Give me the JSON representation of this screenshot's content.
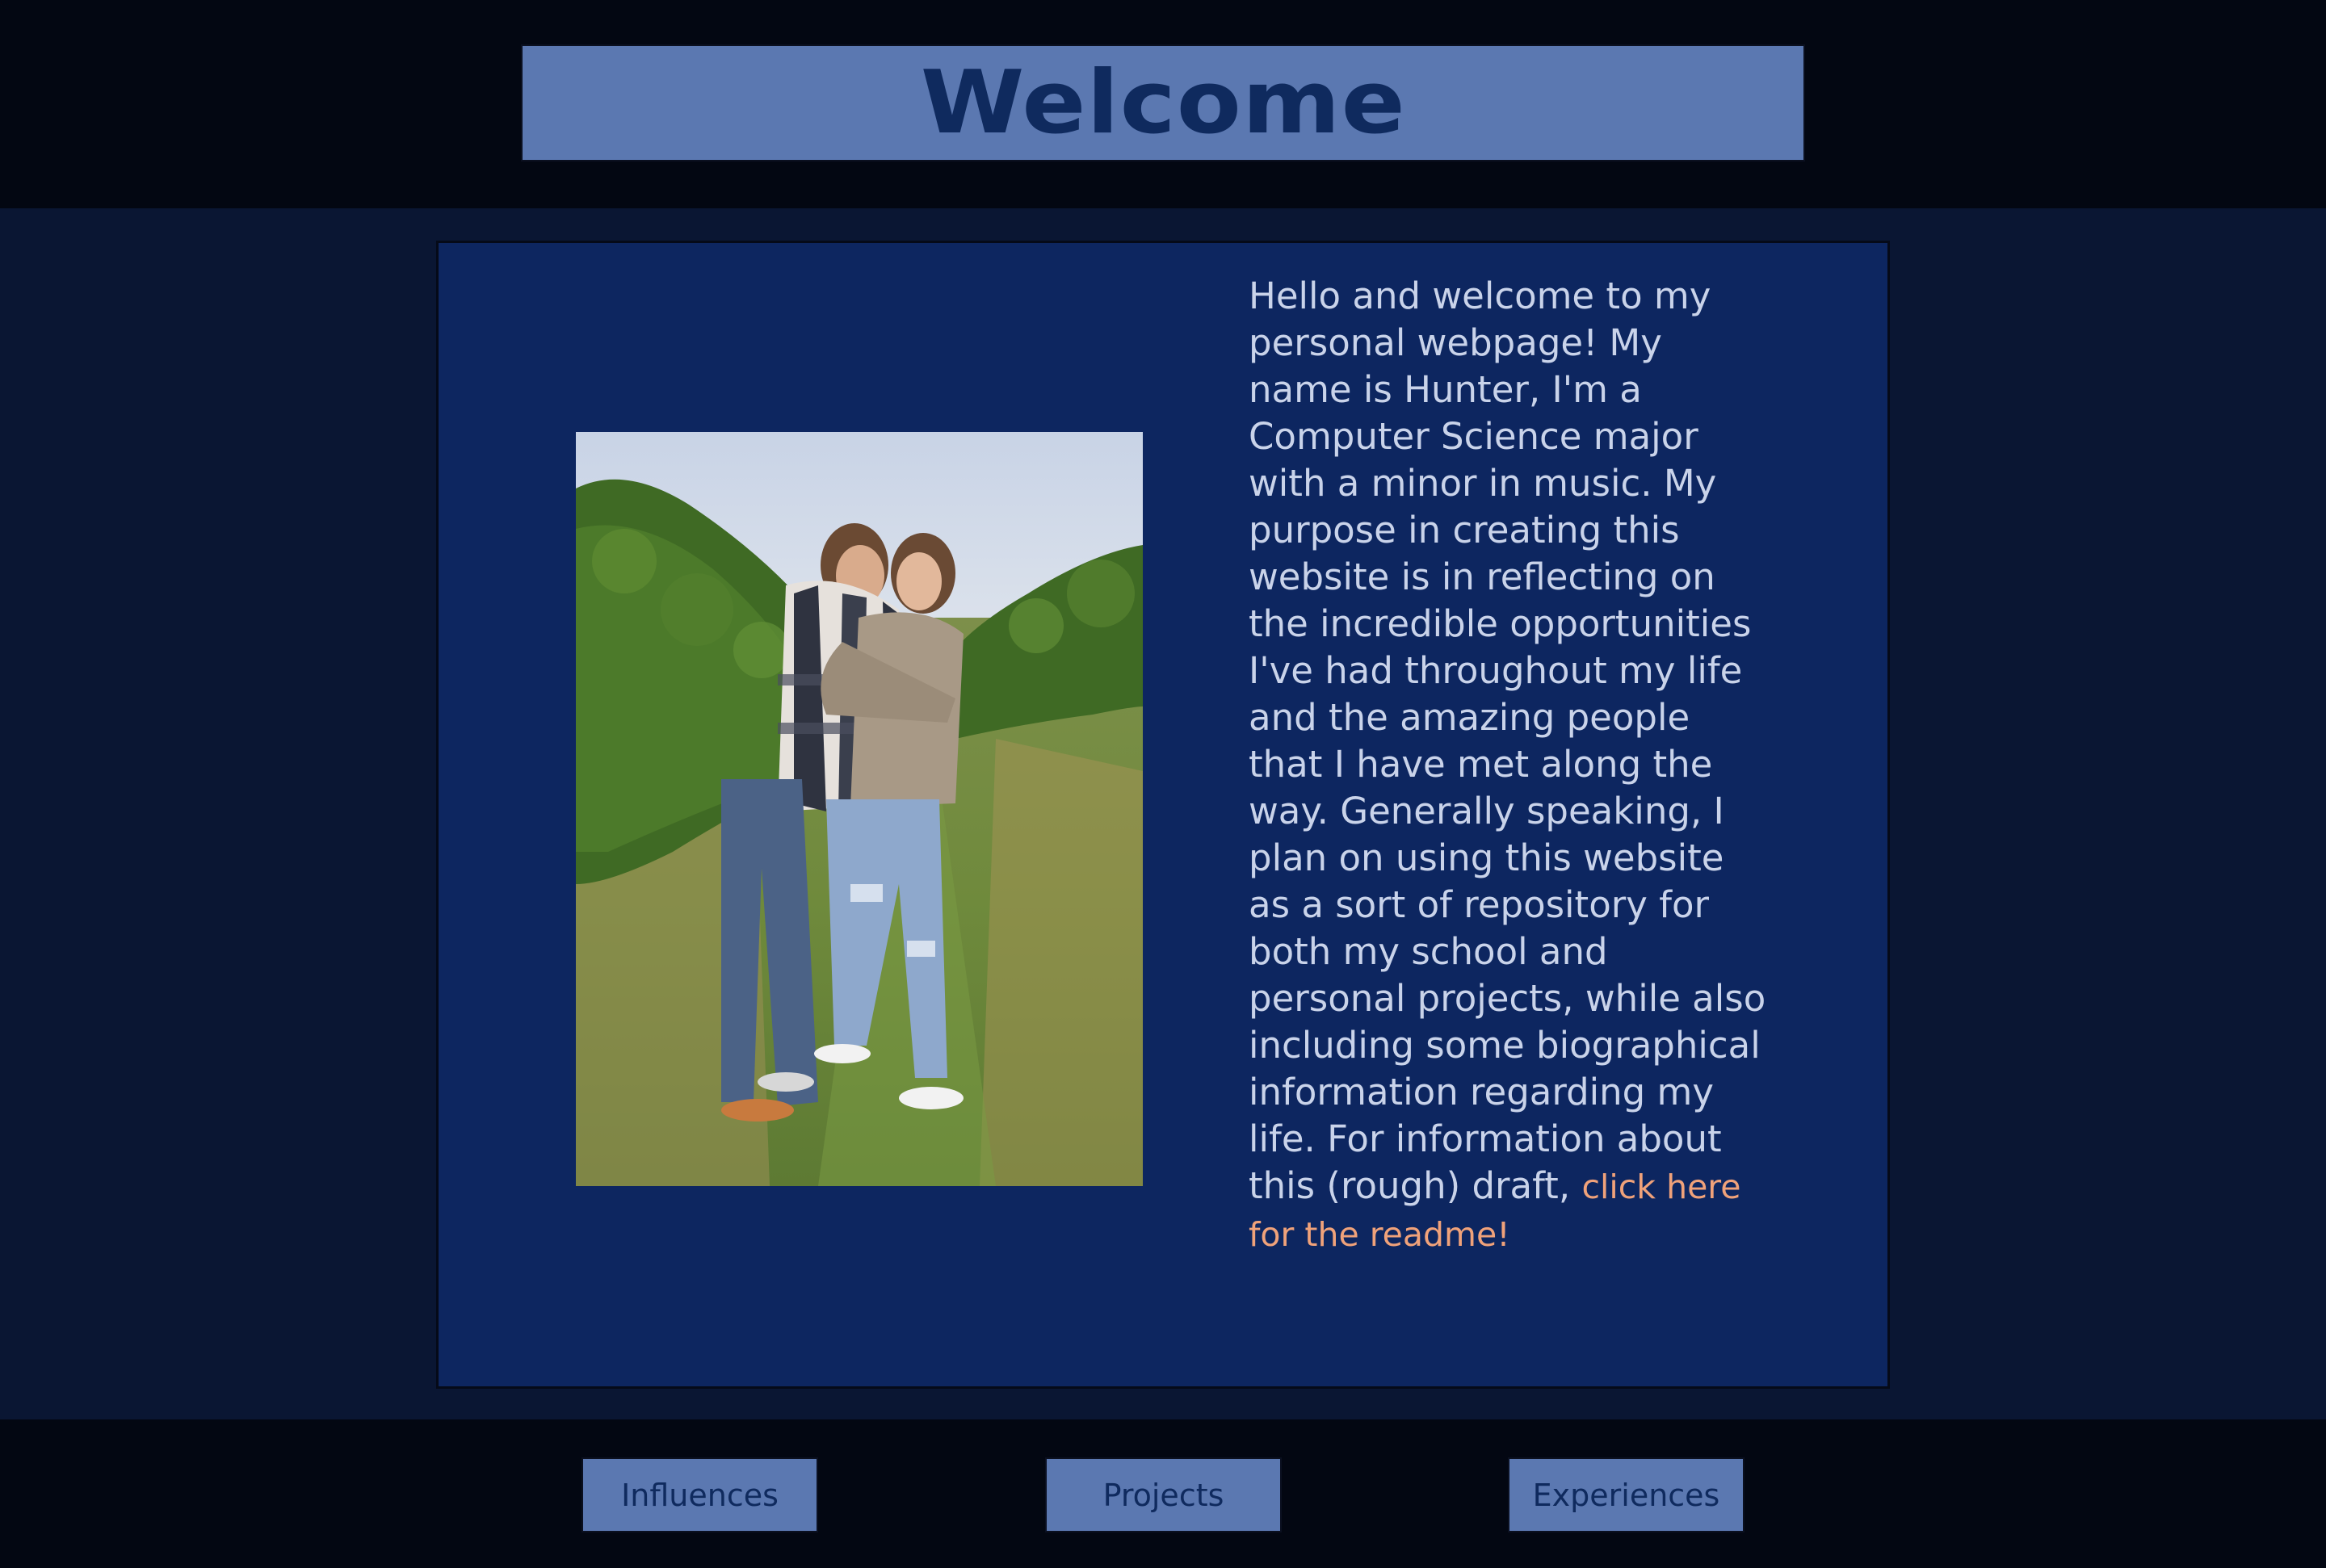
{
  "header": {
    "title": "Welcome"
  },
  "main": {
    "photo_alt": "Photo of Hunter hugging a woman in a vineyard",
    "intro_text": "Hello and welcome to my personal webpage! My name is Hunter, I'm a Computer Science major with a minor in music. My purpose in creating this website is in reflecting on the incredible opportunities I've had throughout my life and the amazing people that I have met along the way. Generally speaking, I plan on using this website as a sort of repository for both my school and personal projects, while also including some biographical information regarding my life. For information about this (rough) draft, ",
    "readme_link": "click here for the readme!"
  },
  "nav": {
    "buttons": [
      {
        "label": "Influences"
      },
      {
        "label": "Projects"
      },
      {
        "label": "Experiences"
      }
    ]
  },
  "colors": {
    "header_bg": "#030712",
    "band_bg": "#0a1633",
    "card_bg": "#0d2660",
    "button_bg": "#5b78b1",
    "title_text": "#0f2a5e",
    "body_text": "#c9d3ea",
    "link_text": "#f0a27a"
  }
}
